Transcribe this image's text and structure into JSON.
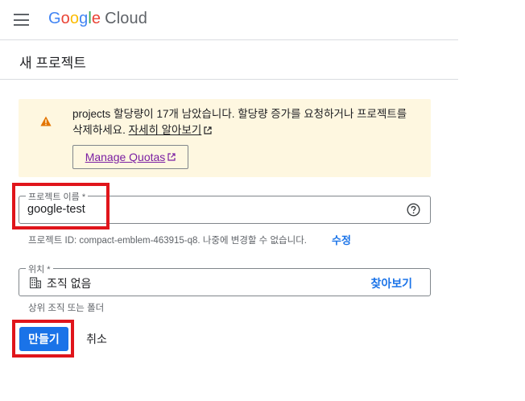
{
  "header": {
    "logo_letters": [
      "G",
      "o",
      "o",
      "g",
      "l",
      "e"
    ],
    "logo_product": "Cloud"
  },
  "page": {
    "title": "새 프로젝트"
  },
  "warning": {
    "text_before": "projects 할당량이 17개 남았습니다. 할당량 증가를 요청하거나 프로젝트를 삭제하세요. ",
    "link_label": "자세히 알아보기",
    "button_label": "Manage Quotas",
    "icon": "warning-icon",
    "color": "#e37400"
  },
  "project_name": {
    "label": "프로젝트 이름 *",
    "value": "google-test",
    "help_icon": "help-icon",
    "hint": "프로젝트 ID: compact-emblem-463915-q8. 나중에 변경할 수 없습니다.",
    "edit_label": "수정"
  },
  "location": {
    "label": "위치 *",
    "value": "조직 없음",
    "icon": "organization-icon",
    "browse_label": "찾아보기",
    "hint": "상위 조직 또는 폴더"
  },
  "actions": {
    "create_label": "만들기",
    "cancel_label": "취소"
  },
  "colors": {
    "accent": "#1a73e8",
    "highlight": "#e0151b",
    "warning_bg": "#fef7e0",
    "quota_link": "#7b1fa2"
  }
}
